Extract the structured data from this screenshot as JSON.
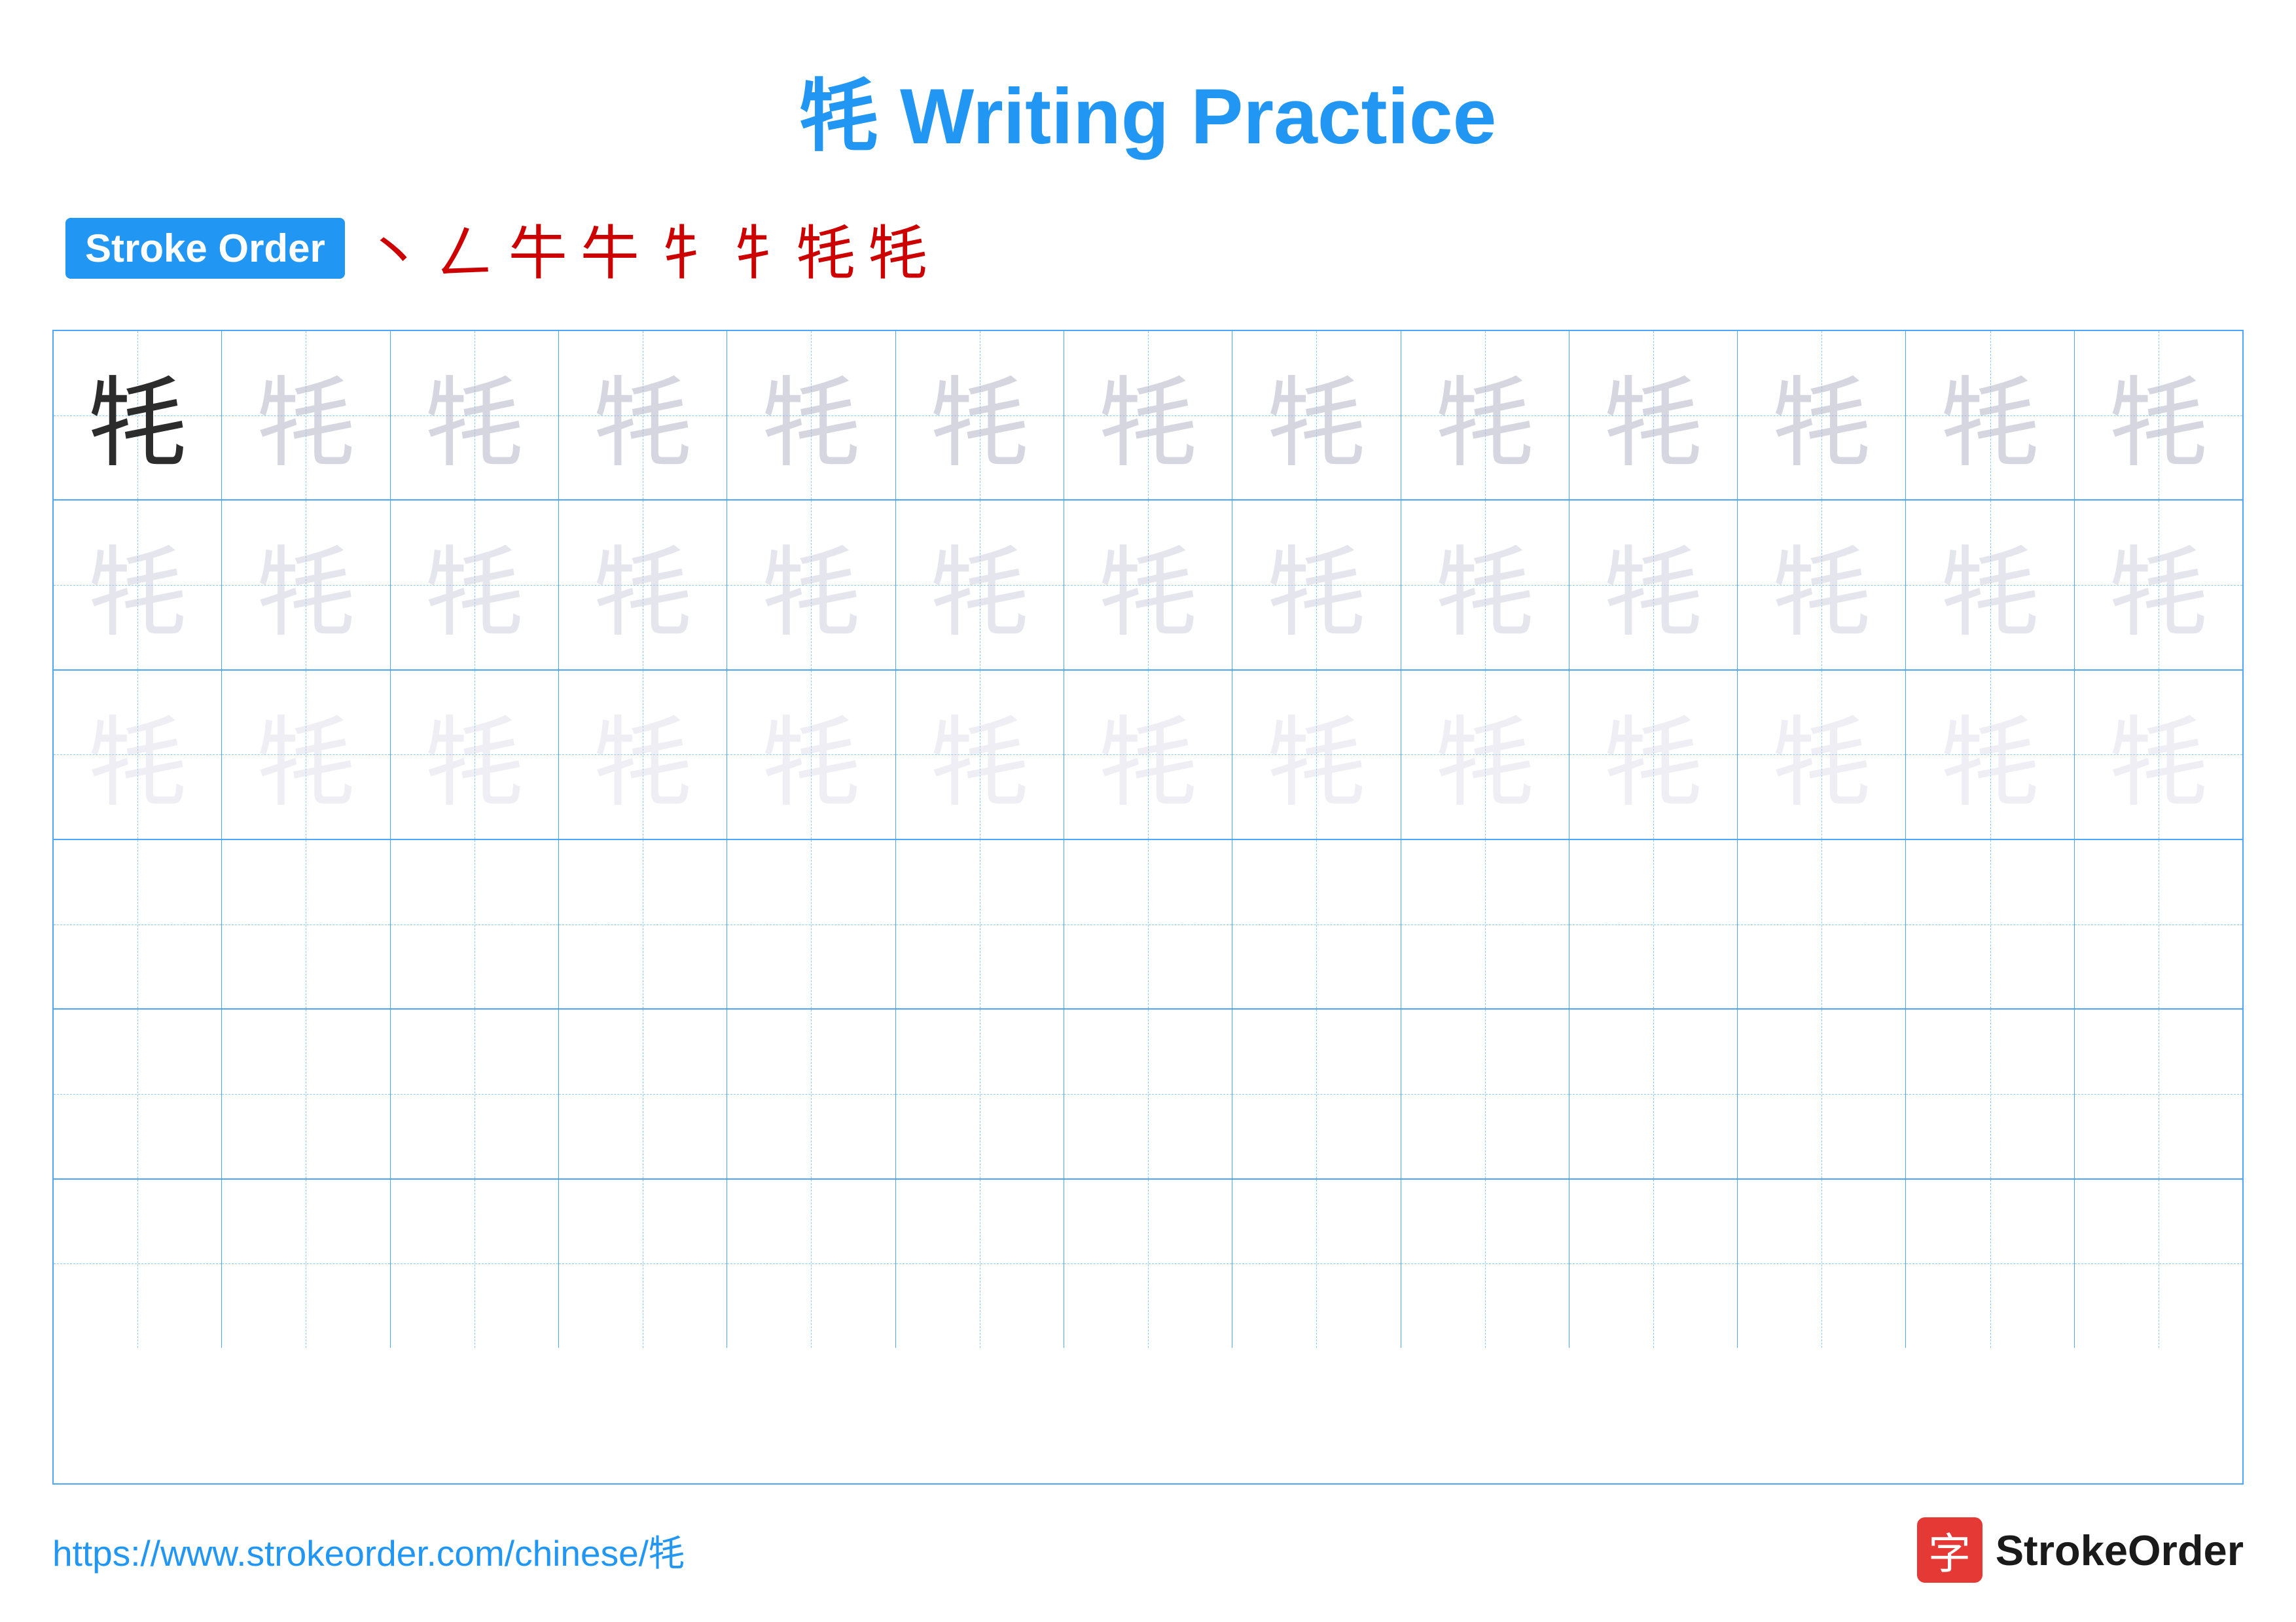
{
  "title": "牦 Writing Practice",
  "stroke_order_label": "Stroke Order",
  "stroke_steps": [
    "丶",
    "𠃋",
    "牛",
    "牛",
    "牜",
    "牜",
    "牦",
    "牦"
  ],
  "character": "牦",
  "rows": 6,
  "cols": 13,
  "row_types": [
    "dark_then_light1",
    "light2",
    "light3",
    "empty",
    "empty",
    "empty"
  ],
  "footer_url": "https://www.strokeorder.com/chinese/牦",
  "footer_logo_char": "字",
  "footer_logo_name": "StrokeOrder"
}
